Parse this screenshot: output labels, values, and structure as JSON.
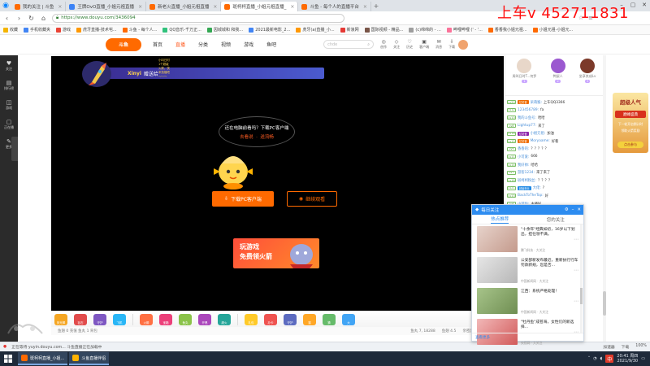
{
  "overlay_text": "上车v 452711831",
  "browser": {
    "tabs": [
      {
        "label": "我的关注 | 斗鱼",
        "active": false,
        "color": "#ff6a00"
      },
      {
        "label": "王牌OvO直播_小姐元祖直播",
        "active": false,
        "color": "#3b82f6"
      },
      {
        "label": "新老火直播_小姐元祖直播",
        "active": false,
        "color": "#ff6a00"
      },
      {
        "label": "斑柯柯直播_小姐元祖直播_",
        "active": true,
        "color": "#ff6a00"
      },
      {
        "label": "斗鱼 - 每个人的直播平台",
        "active": false,
        "color": "#ff6a00"
      }
    ],
    "url": "https://www.douyu.com/3436094",
    "window_controls": [
      "–",
      "▢",
      "✕"
    ]
  },
  "bookmarks": [
    {
      "label": "收藏",
      "color": "#f4b400"
    },
    {
      "label": "手机收藏夹",
      "color": "#4285f4"
    },
    {
      "label": "游戏",
      "color": "#ea4335"
    },
    {
      "label": "虎牙直播-技术宅...",
      "color": "#ff9800"
    },
    {
      "label": "斗鱼 - 每个人...",
      "color": "#ff6a00"
    },
    {
      "label": "QQ音乐-千万正...",
      "color": "#31c27c"
    },
    {
      "label": "因城城和 和我...",
      "color": "#34a853"
    },
    {
      "label": "2021最新电影_2...",
      "color": "#4285f4"
    },
    {
      "label": "虎牙(a)直播_小...",
      "color": "#ff9800"
    },
    {
      "label": "新浪网",
      "color": "#e53935"
    },
    {
      "label": "国际视频 - 精品...",
      "color": "#795548"
    },
    {
      "label": "(c)绵绵的 - ...",
      "color": "#9e9e9e"
    },
    {
      "label": "哔哩哔哩 (' - '...",
      "color": "#fb7299"
    },
    {
      "label": "香香我小姐元祖...",
      "color": "#ff6a00"
    },
    {
      "label": "小姐元祖-小姐元...",
      "color": "#ff6a00"
    }
  ],
  "site": {
    "logo": "斗鱼",
    "nav": [
      "首页",
      "直播",
      "分类",
      "视频",
      "游戏",
      "鱼吧"
    ],
    "nav_active_index": 1,
    "search_placeholder": "chde",
    "header_icons": [
      {
        "glyph": "◎",
        "label": "创作"
      },
      {
        "glyph": "◇",
        "label": "关注"
      },
      {
        "glyph": "♡",
        "label": "历史"
      },
      {
        "glyph": "▣",
        "label": "客户端"
      },
      {
        "glyph": "✉",
        "label": "消息"
      },
      {
        "glyph": "⇩",
        "label": "下载"
      }
    ]
  },
  "left_sidebar": [
    {
      "glyph": "♥",
      "label": "关注"
    },
    {
      "glyph": "▤",
      "label": "排行榜"
    },
    {
      "glyph": "◫",
      "label": "游戏"
    },
    {
      "glyph": "▢",
      "label": "正在播"
    },
    {
      "glyph": "✎",
      "label": "更多"
    }
  ],
  "player": {
    "banner_user": "Xinyi",
    "banner_message": "赠送给",
    "banner_gift": "小叫日时1个超级火箭，快来抢福吧～～～",
    "bubble_text": "还在电脑前看吗？下载PC客户端",
    "bubble_links": [
      "去看说",
      "送流畅"
    ],
    "download_button": "下载PC客户端",
    "continue_button": "继续观看",
    "game_ad_line1": "玩游戏",
    "game_ad_line2": "免费领火箭"
  },
  "gift_bar": {
    "gifts": [
      {
        "color": "#f5a623",
        "label": "荧光棒"
      },
      {
        "color": "#e14b4b",
        "label": "钻石"
      },
      {
        "color": "#7e57c2",
        "label": "守护"
      },
      {
        "color": "#29b6f6",
        "label": "飞机"
      },
      {
        "color": "#ff7043",
        "label": "火箭"
      },
      {
        "color": "#ec407a",
        "label": "宝箱"
      },
      {
        "color": "#8bc34a",
        "label": "鱼丸"
      },
      {
        "color": "#ab47bc",
        "label": "开黑"
      },
      {
        "color": "#26a69a",
        "label": "超火"
      },
      {
        "color": "#ffca28",
        "label": "礼包"
      },
      {
        "color": "#ef5350",
        "label": "办卡"
      },
      {
        "color": "#5c6bc0",
        "label": "守护"
      },
      {
        "color": "#ffa726",
        "label": "猫"
      },
      {
        "color": "#66bb6a",
        "label": "猜"
      },
      {
        "color": "#42a5f5",
        "label": "大"
      }
    ],
    "bottom_text": "鱼翅 0  充值  鱼丸 1  背包",
    "stats": [
      "鱼丸 7,  18288",
      "鱼翅 4.5",
      "亲密度 19"
    ]
  },
  "top_ranks": [
    {
      "name": "周叫日时T...何罗",
      "tag": "1",
      "color": "#e8d7c9"
    },
    {
      "name": "鸭梨人",
      "tag": "2",
      "color": "#9b59d0"
    },
    {
      "name": "坐享其成Lv",
      "tag": "3",
      "color": "#7c3a2a"
    }
  ],
  "chat": [
    {
      "lv": "Lv20",
      "medal": "忆初音",
      "medal_color": "#ef6c00",
      "nick": "呆萌猴:",
      "text": "上车QQ3366"
    },
    {
      "lv": "Lv12",
      "medal": "",
      "medal_color": "",
      "nick": "123456789:",
      "text": "fa"
    },
    {
      "lv": "Lv10",
      "medal": "",
      "medal_color": "",
      "nick": "我的斗鱼号:",
      "text": "哈哈"
    },
    {
      "lv": "Lv8",
      "medal": "",
      "medal_color": "",
      "nick": "Lightup77:",
      "text": "来了"
    },
    {
      "lv": "Lv18",
      "medal": "忆初音",
      "medal_color": "#8e24aa",
      "nick": "小姐元祖:",
      "text": "加油"
    },
    {
      "lv": "Lv15",
      "medal": "忆初音",
      "medal_color": "#ef6c00",
      "nick": "Moryaame:",
      "text": "好看"
    },
    {
      "lv": "Lv9",
      "medal": "",
      "medal_color": "",
      "nick": "香香的:",
      "text": "？？？？？"
    },
    {
      "lv": "Lv11",
      "medal": "",
      "medal_color": "",
      "nick": "小可爱:",
      "text": "666"
    },
    {
      "lv": "Lv14",
      "medal": "",
      "medal_color": "",
      "nick": "我好帅:",
      "text": "哈哈"
    },
    {
      "lv": "Lv7",
      "medal": "",
      "medal_color": "",
      "nick": "游客1234:",
      "text": "来了来了"
    },
    {
      "lv": "Lv16",
      "medal": "",
      "medal_color": "",
      "nick": "斑柯柯粉丝:",
      "text": "？？？？"
    },
    {
      "lv": "Lv21",
      "medal": "超级粉丝",
      "medal_color": "#1e88e5",
      "nick": "大佬:",
      "text": "?"
    },
    {
      "lv": "Lv13",
      "medal": "",
      "medal_color": "",
      "nick": "BackToTheTop:",
      "text": "好"
    },
    {
      "lv": "Lv6",
      "medal": "",
      "medal_color": "",
      "nick": "小可怜:",
      "text": "主播好"
    }
  ],
  "right_ad": {
    "title": "超级人气",
    "subtitle": "巅峰盛典",
    "line1": "下一轮开启倒计时",
    "line2": "领取火箭奖励",
    "cta": "点击参与"
  },
  "popup": {
    "title": "每日关注",
    "controls": [
      "⚙",
      "–",
      "✕"
    ],
    "tabs": [
      "热点推荐",
      "您的关注"
    ],
    "active_tab": 0,
    "news": [
      {
        "text": "\"十余年\"经典如初，16岁以下划出，担任领不满。",
        "source": "腾飞科技 · 大关注",
        "colors": [
          "#e7d3cb",
          "#c49a8c"
        ]
      },
      {
        "text": "公安部新发布最近，重新执行行车罚款新规，您是否...",
        "source": "中国新闻网 · 大关注",
        "colors": [
          "#e6e6e6",
          "#b7b7b7"
        ]
      },
      {
        "text": "江西：系统严格处理！",
        "source": "中国新闻网 · 大关注",
        "colors": [
          "#a7c48a",
          "#6f8e52"
        ]
      },
      {
        "text": "\"牡丹鱼\"成苍海，女性们的新选择...",
        "source": "央视网 · 大关注",
        "colors": [
          "#f2b8b8",
          "#d25a5a"
        ]
      }
    ],
    "footer": "查看更多"
  },
  "statusbar": {
    "left": "正在等待 yuyin.douyu.com... 斗鱼直播正在加载中",
    "right": [
      "加速器",
      "下载",
      "100%"
    ]
  },
  "taskbar": {
    "items": [
      {
        "label": "斑柯柯直播_小姐...",
        "color": "#ff6a00"
      },
      {
        "label": "斗鱼直播伴侣",
        "color": "#ffb300"
      }
    ],
    "tray_text": "中",
    "time": "20:41 周四",
    "date": "2021/9/30"
  }
}
